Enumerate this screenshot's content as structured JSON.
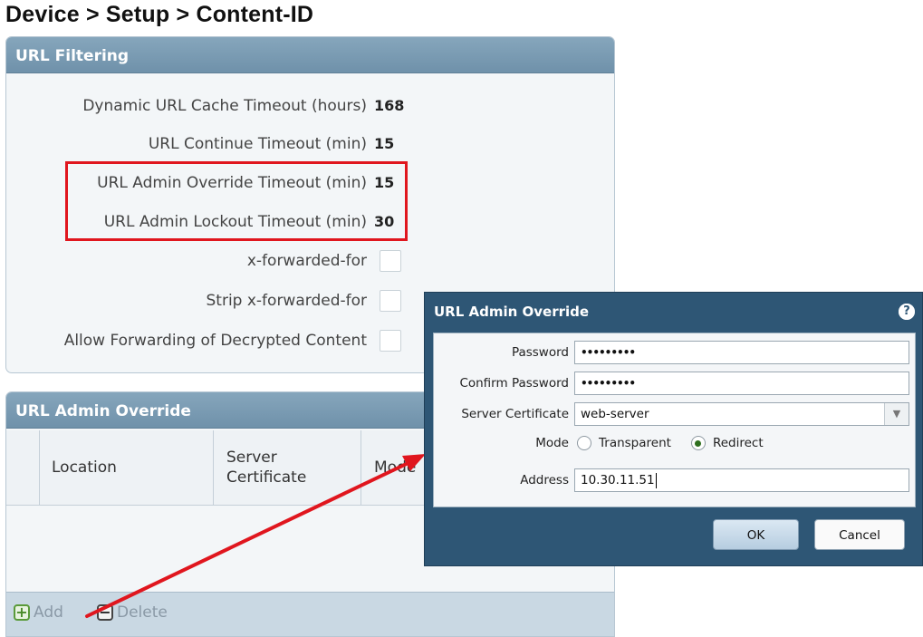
{
  "page": {
    "title": "Device > Setup > Content-ID"
  },
  "url_filtering": {
    "title": "URL Filtering",
    "rows": [
      {
        "label": "Dynamic URL Cache Timeout (hours)",
        "value": "168"
      },
      {
        "label": "URL Continue Timeout (min)",
        "value": "15"
      },
      {
        "label": "URL Admin Override Timeout (min)",
        "value": "15"
      },
      {
        "label": "URL Admin Lockout Timeout (min)",
        "value": "30"
      }
    ],
    "checkboxes": [
      {
        "label": "x-forwarded-for",
        "checked": false
      },
      {
        "label": "Strip x-forwarded-for",
        "checked": false
      },
      {
        "label": "Allow Forwarding of Decrypted Content",
        "checked": false
      }
    ],
    "highlight_color": "#e0161e"
  },
  "admin_override_panel": {
    "title": "URL Admin Override",
    "columns": [
      "Location",
      "Server Certificate",
      "Mode"
    ],
    "footer": {
      "add_label": "Add",
      "delete_label": "Delete"
    }
  },
  "dialog": {
    "title": "URL Admin Override",
    "password_label": "Password",
    "password_value": "•••••••••",
    "confirm_label": "Confirm Password",
    "confirm_value": "•••••••••",
    "cert_label": "Server Certificate",
    "cert_value": "web-server",
    "mode_label": "Mode",
    "mode_options": [
      "Transparent",
      "Redirect"
    ],
    "mode_selected": "Redirect",
    "address_label": "Address",
    "address_value": "10.30.11.51",
    "ok_label": "OK",
    "cancel_label": "Cancel"
  },
  "colors": {
    "panel_header": "#7a9bb2",
    "dialog_bg": "#2e5675",
    "arrow": "#e0161e"
  }
}
